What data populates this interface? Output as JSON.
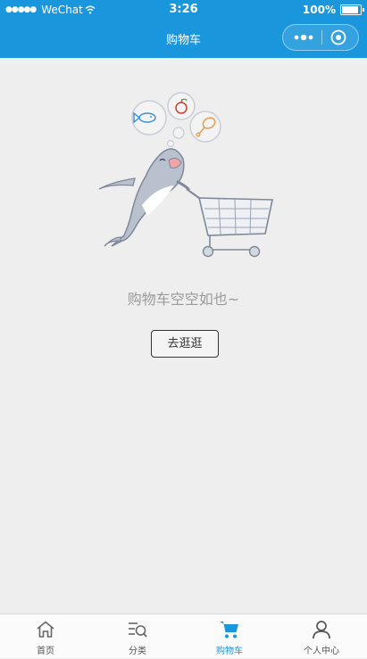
{
  "status_bar": {
    "carrier": "WeChat",
    "time": "3:26",
    "battery": "100%",
    "battery_level": 1.0
  },
  "navbar": {
    "title": "购物车"
  },
  "empty_state": {
    "message": "购物车空空如也~",
    "button_label": "去逛逛"
  },
  "tabbar": {
    "items": [
      {
        "label": "首页",
        "icon": "home-icon"
      },
      {
        "label": "分类",
        "icon": "category-icon"
      },
      {
        "label": "购物车",
        "icon": "cart-icon",
        "active": true
      },
      {
        "label": "个人中心",
        "icon": "user-icon"
      }
    ]
  },
  "colors": {
    "brand": "#1a96dc",
    "background": "#eeeeee",
    "muted_text": "#9a9a9a"
  }
}
